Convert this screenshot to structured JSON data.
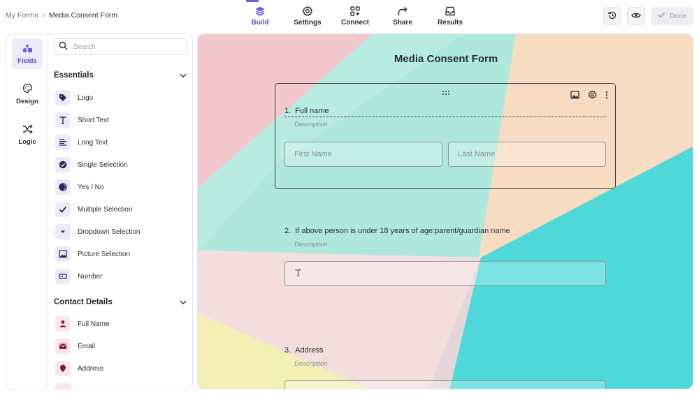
{
  "breadcrumb": {
    "root": "My Forms",
    "separator": "›",
    "current": "Media Consent Form"
  },
  "nav": [
    {
      "id": "build",
      "label": "Build",
      "icon": "layers-icon",
      "active": true
    },
    {
      "id": "settings",
      "label": "Settings",
      "icon": "gear-icon",
      "active": false
    },
    {
      "id": "connect",
      "label": "Connect",
      "icon": "integrations-icon",
      "active": false
    },
    {
      "id": "share",
      "label": "Share",
      "icon": "share-arrow-icon",
      "active": false
    },
    {
      "id": "results",
      "label": "Results",
      "icon": "inbox-icon",
      "active": false
    }
  ],
  "actions": {
    "done_label": "Done"
  },
  "rail": [
    {
      "label": "Fields",
      "icon": "shapes-icon",
      "active": true
    },
    {
      "label": "Design",
      "icon": "palette-icon",
      "active": false
    },
    {
      "label": "Logic",
      "icon": "shuffle-icon",
      "active": false
    }
  ],
  "search": {
    "placeholder": "Search"
  },
  "sections": {
    "essentials": {
      "title": "Essentials",
      "items": [
        {
          "label": "Logo",
          "icon": "tag-icon"
        },
        {
          "label": "Short Text",
          "icon": "text-t-icon"
        },
        {
          "label": "Long Text",
          "icon": "paragraph-icon"
        },
        {
          "label": "Single Selection",
          "icon": "check-circle-icon"
        },
        {
          "label": "Yes / No",
          "icon": "half-circle-icon"
        },
        {
          "label": "Multiple Selection",
          "icon": "checkmark-icon"
        },
        {
          "label": "Dropdown Selection",
          "icon": "caret-down-icon"
        },
        {
          "label": "Picture Selection",
          "icon": "picture-icon"
        },
        {
          "label": "Number",
          "icon": "number-field-icon"
        }
      ]
    },
    "contact": {
      "title": "Contact Details",
      "items": [
        {
          "label": "Full Name",
          "icon": "person-icon"
        },
        {
          "label": "Email",
          "icon": "envelope-icon"
        },
        {
          "label": "Address",
          "icon": "location-pin-icon"
        }
      ]
    }
  },
  "form": {
    "title": "Media Consent Form",
    "questions": [
      {
        "number": "1.",
        "title": "Full name",
        "description": "Description",
        "first_placeholder": "First Name",
        "last_placeholder": "Last Name"
      },
      {
        "number": "2.",
        "title": "If above person is under 18 years of age:parent/guardian name",
        "description": "Description"
      },
      {
        "number": "3.",
        "title": "Address",
        "description": "Description"
      }
    ]
  },
  "colors": {
    "accent": "#6d5ce0",
    "contact_icon": "#8a1538"
  }
}
